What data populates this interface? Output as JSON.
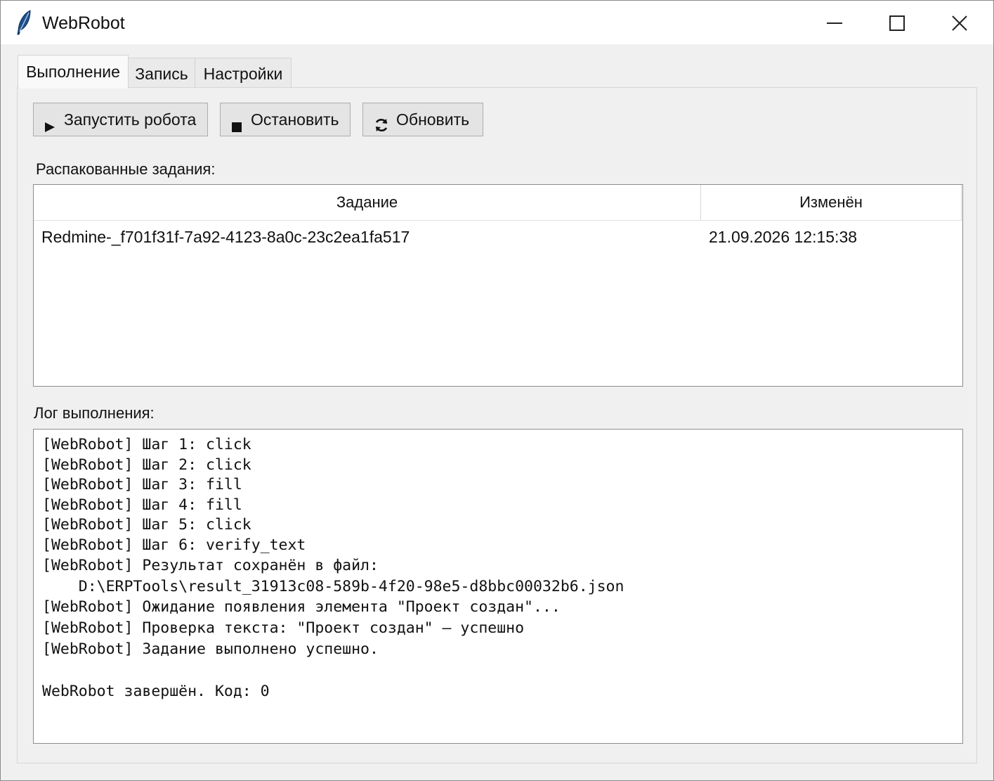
{
  "window": {
    "title": "WebRobot",
    "icon": "feather-icon",
    "controls": [
      "minimize-icon",
      "maximize-icon",
      "close-icon"
    ]
  },
  "tabs": [
    {
      "label": "Выполнение",
      "active": true
    },
    {
      "label": "Запись",
      "active": false
    },
    {
      "label": "Настройки",
      "active": false
    }
  ],
  "toolbar": {
    "start_label": "Запустить робота",
    "stop_label": "Остановить",
    "refresh_label": "Обновить"
  },
  "tasks": {
    "label": "Распакованные задания:",
    "columns": [
      "Задание",
      "Изменён"
    ],
    "rows": [
      {
        "task": "Redmine-_f701f31f-7a92-4123-8a0c-23c2ea1fa517",
        "modified": "21.09.2026 12:15:38"
      }
    ]
  },
  "log": {
    "label": "Лог выполнения:",
    "lines": [
      "[WebRobot] Шаг 1: click",
      "[WebRobot] Шаг 2: click",
      "[WebRobot] Шаг 3: fill",
      "[WebRobot] Шаг 4: fill",
      "[WebRobot] Шаг 5: click",
      "[WebRobot] Шаг 6: verify_text",
      "[WebRobot] Результат сохранён в файл:",
      "    D:\\ERPTools\\result_31913c08-589b-4f20-98e5-d8bbc00032b6.json",
      "[WebRobot] Ожидание появления элемента \"Проект создан\"...",
      "[WebRobot] Проверка текста: \"Проект создан\" — успешно",
      "[WebRobot] Задание выполнено успешно.",
      "",
      "WebRobot завершён. Код: 0"
    ]
  }
}
